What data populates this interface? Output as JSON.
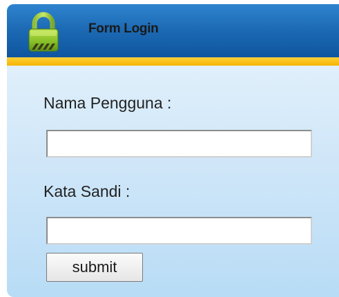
{
  "header": {
    "title": "Form Login",
    "icon": "padlock-icon",
    "color_primary": "#1d6bb5",
    "color_accent": "#f5b400"
  },
  "form": {
    "username_label": "Nama Pengguna :",
    "username_value": "",
    "password_label": "Kata Sandi :",
    "password_value": "",
    "submit_label": "submit"
  }
}
